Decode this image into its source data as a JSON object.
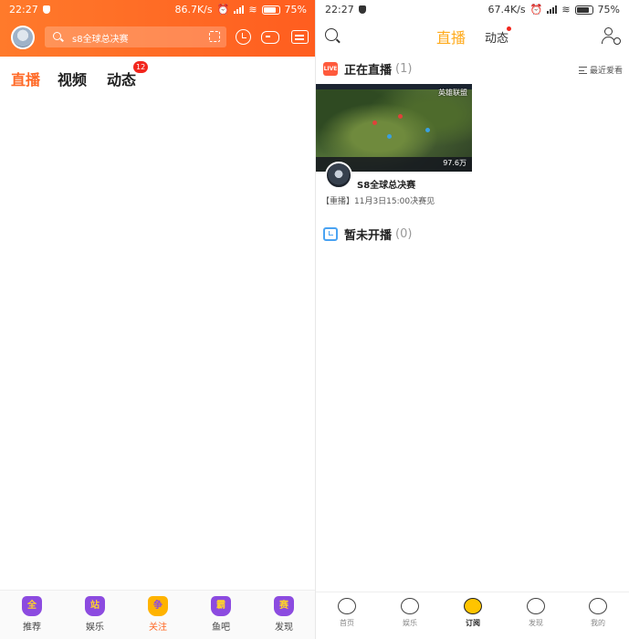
{
  "left": {
    "status": {
      "time": "22:27",
      "speed": "86.7K/s",
      "battery": "75%"
    },
    "search": {
      "placeholder": "s8全球总决赛"
    },
    "tabs": [
      {
        "label": "直播",
        "active": true
      },
      {
        "label": "视频",
        "active": false
      },
      {
        "label": "动态",
        "active": false,
        "badge": "12"
      }
    ],
    "bottom_nav": [
      {
        "label": "推荐",
        "glyph": "全",
        "active": false
      },
      {
        "label": "娱乐",
        "glyph": "站",
        "active": false
      },
      {
        "label": "关注",
        "glyph": "争",
        "active": true
      },
      {
        "label": "鱼吧",
        "glyph": "霸",
        "active": false
      },
      {
        "label": "发现",
        "glyph": "赛",
        "active": false
      }
    ],
    "colors": {
      "accent": "#ff6a27",
      "header": "#ff6624",
      "badge": "#f2261d"
    }
  },
  "right": {
    "status": {
      "time": "22:27",
      "speed": "67.4K/s",
      "battery": "75%"
    },
    "top_tabs": [
      {
        "label": "直播",
        "active": true
      },
      {
        "label": "动态",
        "active": false
      }
    ],
    "live_section": {
      "title": "正在直播",
      "count": "(1)",
      "live_icon_text": "LIVE",
      "sort_label": "最近爱看"
    },
    "stream": {
      "game_tag": "英雄联盟",
      "viewers": "97.6万",
      "title": "S8全球总决赛",
      "subtitle": "【重播】11月3日15:00决赛见"
    },
    "offline_section": {
      "title": "暂未开播",
      "count": "(0)"
    },
    "bottom_nav": [
      {
        "label": "首页",
        "active": false
      },
      {
        "label": "娱乐",
        "active": false
      },
      {
        "label": "订阅",
        "active": true
      },
      {
        "label": "发现",
        "active": false
      },
      {
        "label": "我的",
        "active": false
      }
    ],
    "colors": {
      "accent": "#ffaa1a",
      "live_icon": "#ff5a3c",
      "calendar_icon": "#4aa3f2"
    }
  }
}
